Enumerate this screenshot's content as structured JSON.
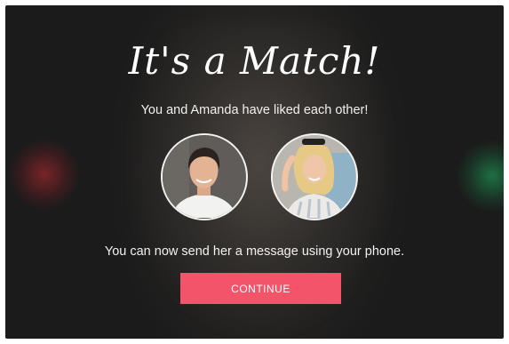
{
  "match": {
    "title": "It's a Match!",
    "subtitle": "You and Amanda have liked each other!",
    "message": "You can now send her a message using your phone.",
    "continue_label": "CONTINUE"
  },
  "colors": {
    "accent": "#f4546a",
    "background": "#1b1b1b"
  }
}
